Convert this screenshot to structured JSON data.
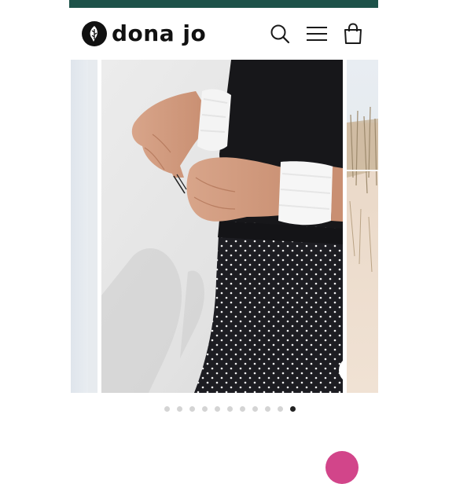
{
  "colors": {
    "topbar": "#1d5249",
    "icon": "#1a1a1a",
    "dot_inactive": "#d4d4d4",
    "dot_active": "#222222",
    "chat_bubble": "#d2458a"
  },
  "brand": {
    "name": "dona jo",
    "mark_icon": "leaf-icon"
  },
  "header": {
    "search_icon": "search-icon",
    "menu_icon": "hamburger-menu-icon",
    "cart_icon": "shopping-bag-icon"
  },
  "gallery": {
    "slide_count": 11,
    "active_index": 10,
    "zoom_icon": "magnify-icon"
  }
}
